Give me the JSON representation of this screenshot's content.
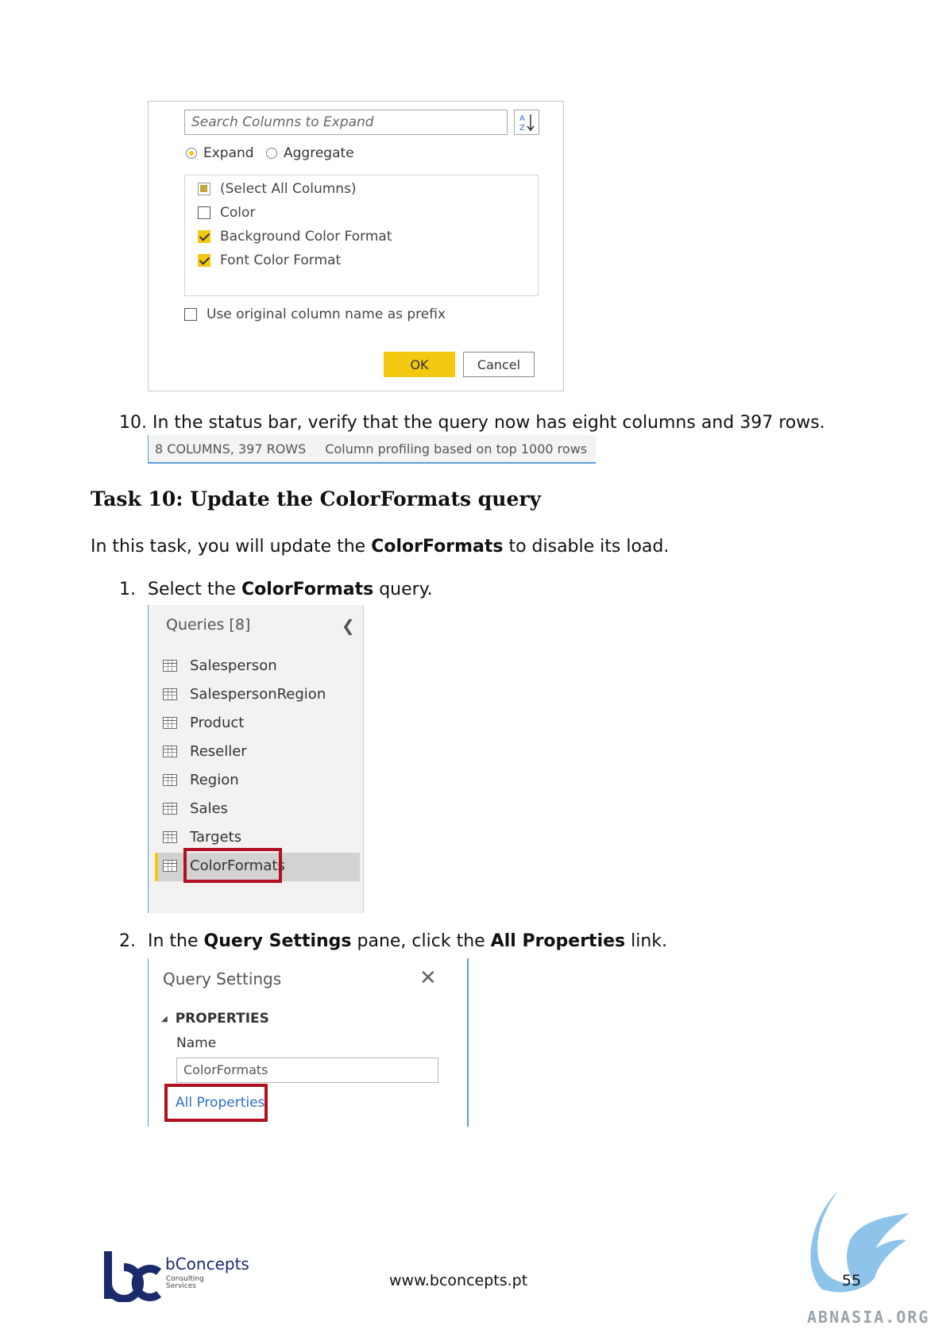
{
  "expand_dialog": {
    "search_placeholder": "Search Columns to Expand",
    "sort_icon": "sort-az-icon",
    "radio_expand": "Expand",
    "radio_aggregate": "Aggregate",
    "columns": [
      {
        "label": "(Select All Columns)",
        "state": "partial"
      },
      {
        "label": "Color",
        "state": "unchecked"
      },
      {
        "label": "Background Color Format",
        "state": "checked"
      },
      {
        "label": "Font Color Format",
        "state": "checked"
      }
    ],
    "prefix_label": "Use original column name as prefix",
    "ok_label": "OK",
    "cancel_label": "Cancel",
    "accent_color": "#f2c811"
  },
  "step10": {
    "number": "10.",
    "text": "In the status bar, verify that the query now has eight columns and 397 rows."
  },
  "status_bar": {
    "columns_rows": "8 COLUMNS, 397 ROWS",
    "profiling": "Column profiling based on top 1000 rows"
  },
  "task": {
    "heading": "Task 10: Update the ColorFormats query",
    "intro_pre": "In this task, you will update the ",
    "intro_bold": "ColorFormats",
    "intro_post": " to disable its load."
  },
  "step1": {
    "number": "1.",
    "pre": "Select the ",
    "bold": "ColorFormats",
    "post": " query."
  },
  "queries_pane": {
    "title": "Queries [8]",
    "collapse_icon": "chevron-left-icon",
    "items": [
      "Salesperson",
      "SalespersonRegion",
      "Product",
      "Reseller",
      "Region",
      "Sales",
      "Targets",
      "ColorFormats"
    ],
    "selected": "ColorFormats",
    "highlight_color": "#b0101f"
  },
  "step2": {
    "number": "2.",
    "pre": "In the ",
    "bold1": "Query Settings",
    "mid": " pane, click the ",
    "bold2": "All Properties",
    "post": " link."
  },
  "query_settings": {
    "title": "Query Settings",
    "close_icon": "close-icon",
    "section": "PROPERTIES",
    "name_label": "Name",
    "name_value": "ColorFormats",
    "all_properties": "All Properties",
    "link_color": "#2e6dc7"
  },
  "footer": {
    "brand_name": "bConcepts",
    "brand_tag1": "Consulting",
    "brand_tag2": "Services",
    "url": "www.bconcepts.pt",
    "page_number": "55",
    "watermark": "ABNASIA.ORG",
    "brand_color": "#1a2a6c"
  }
}
